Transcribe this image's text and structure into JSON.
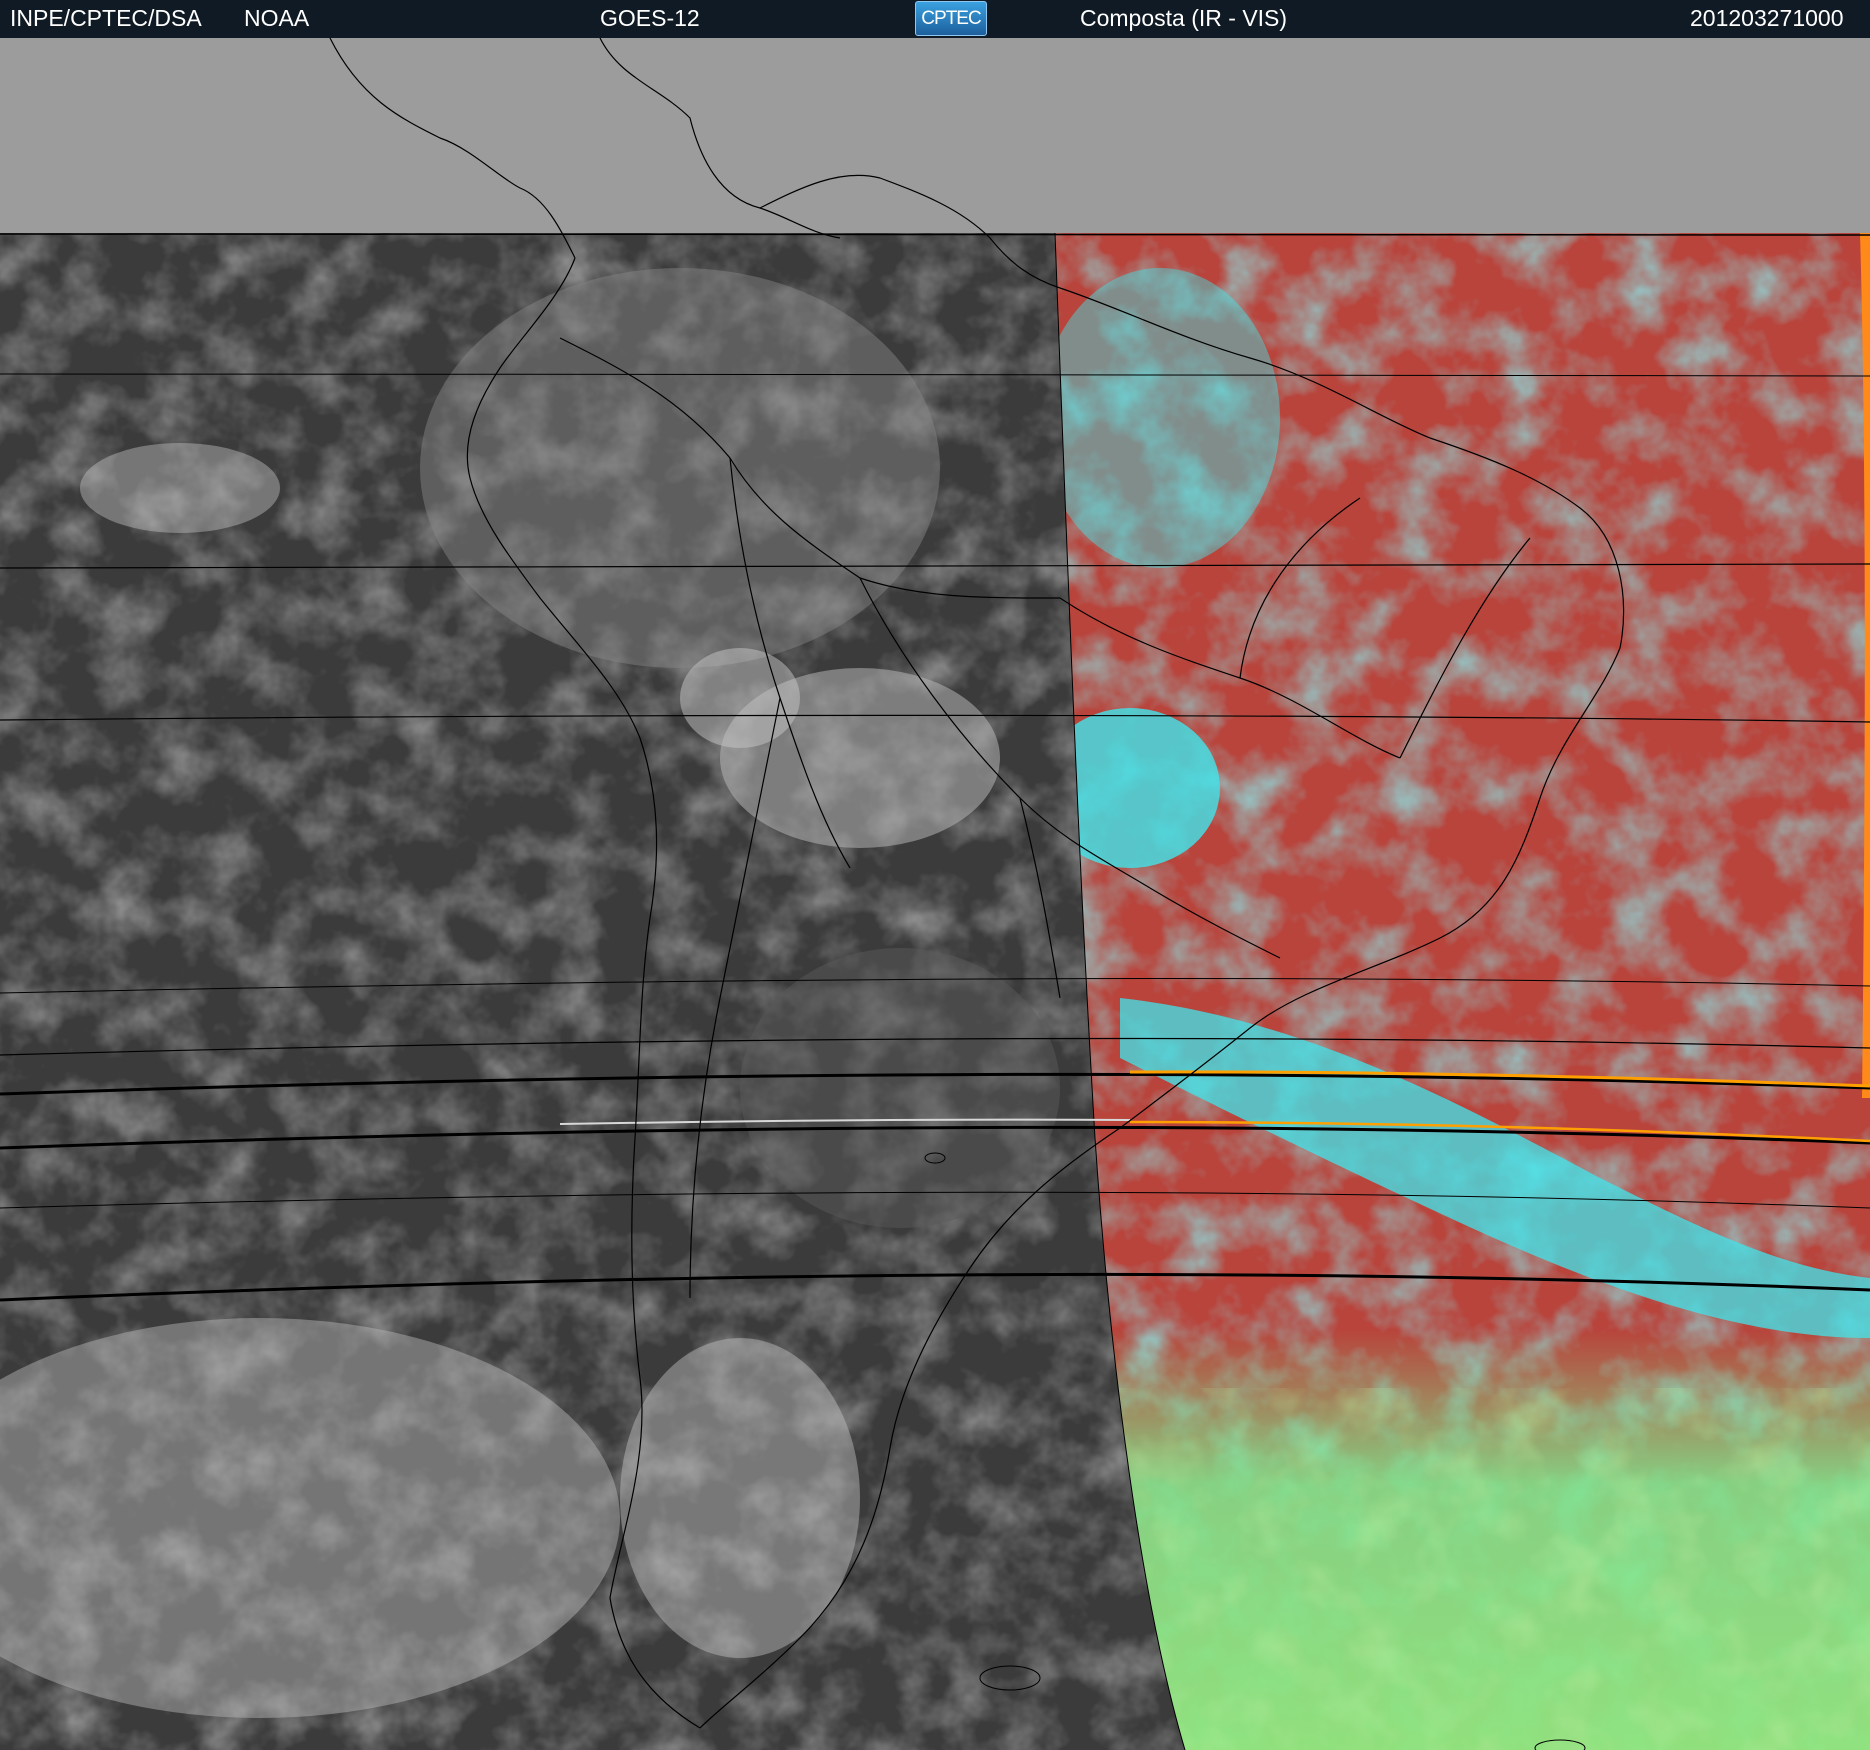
{
  "header": {
    "institution": "INPE/CPTEC/DSA",
    "agency": "NOAA",
    "satellite": "GOES-12",
    "logo_text": "CPTEC",
    "product": "Composta (IR - VIS)",
    "timestamp": "201203271000"
  },
  "colors": {
    "header_bg": "#0f1a24",
    "no_data": "#9c9c9c",
    "ir_dark": "#3b3b3b",
    "vis_land": "#b8443c",
    "vis_cloud_cyan": "#3fe6ec",
    "vis_southern_green": "#7ee88e"
  }
}
